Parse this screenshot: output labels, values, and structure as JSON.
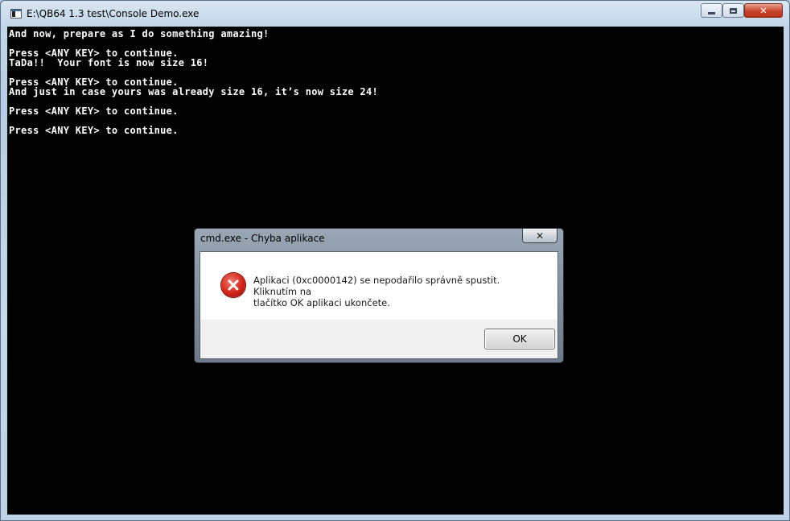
{
  "window": {
    "title": "E:\\QB64 1.3 test\\Console Demo.exe",
    "close_label": "✕"
  },
  "console": {
    "lines": [
      "And now, prepare as I do something amazing!",
      "",
      "Press <ANY KEY> to continue.",
      "TaDa!!  Your font is now size 16!",
      "",
      "Press <ANY KEY> to continue.",
      "And just in case yours was already size 16, it’s now size 24!",
      "",
      "Press <ANY KEY> to continue.",
      "",
      "Press <ANY KEY> to continue."
    ]
  },
  "dialog": {
    "title": "cmd.exe - Chyba aplikace",
    "close_label": "✕",
    "message_line1": "Aplikaci (0xc0000142) se nepodařilo správně spustit. Kliknutím na",
    "message_line2": "tlačítko OK aplikaci ukončete.",
    "icon": "error-icon",
    "ok_label": "OK"
  },
  "colors": {
    "console_bg": "#000000",
    "console_text": "#ffffff",
    "error_red": "#d0241a"
  }
}
